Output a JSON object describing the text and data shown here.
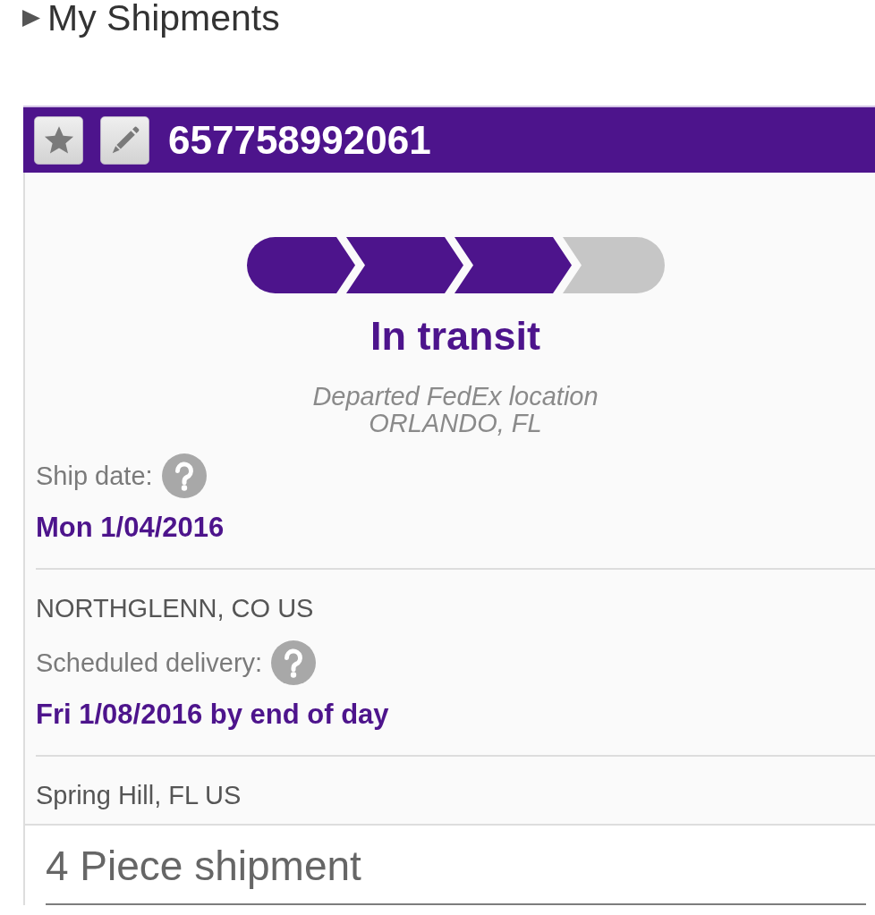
{
  "section": {
    "title": "My Shipments"
  },
  "shipment": {
    "tracking_number": "657758992061",
    "progress": {
      "steps": [
        {
          "completed": true
        },
        {
          "completed": true
        },
        {
          "completed": true
        },
        {
          "completed": false
        }
      ]
    },
    "status": {
      "title": "In transit",
      "detail": "Departed FedEx location",
      "location": "ORLANDO, FL"
    },
    "details": [
      {
        "label": "Ship date:",
        "value": "Mon 1/04/2016",
        "location": "NORTHGLENN, CO US"
      },
      {
        "label": "Scheduled delivery:",
        "value": "Fri 1/08/2016 by end of day",
        "location": "Spring Hill, FL US"
      }
    ]
  },
  "pieces": {
    "title": "4 Piece shipment"
  }
}
